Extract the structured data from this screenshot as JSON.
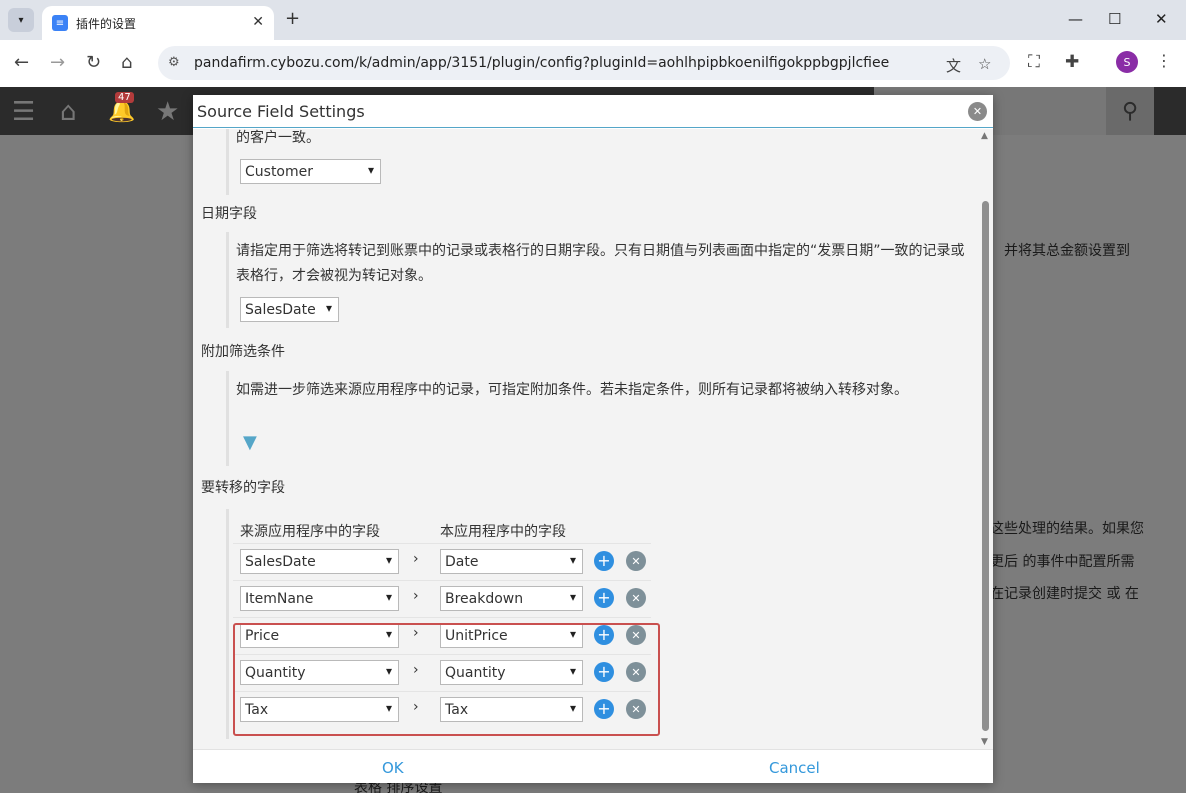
{
  "browser": {
    "tab_title": "插件的设置",
    "url": "pandafirm.cybozu.com/k/admin/app/3151/plugin/config?pluginId=aohlhpipbkoenilfigokppbgpjlcfiee",
    "profile_initial": "S",
    "icons": {
      "tab_menu": "▾",
      "close": "✕",
      "new_tab": "+",
      "minimize": "—",
      "maximize": "☐",
      "back": "←",
      "forward": "→",
      "reload": "↻",
      "home": "⌂",
      "site_info": "⚙",
      "translate": "文",
      "bookmark": "☆",
      "screenshot": "⛶",
      "extensions": "✚",
      "menu": "⋮"
    }
  },
  "app_header": {
    "notification_count": "47",
    "icons": {
      "menu": "☰",
      "home": "⌂",
      "bell": "🔔",
      "star": "★",
      "search": "⚲"
    }
  },
  "background_text": {
    "line1": "并将其总金额设置到",
    "line2": "这些处理的结果。如果您",
    "line3": "更后 的事件中配置所需",
    "line4": "在记录创建时提交 或 在",
    "bottom": "表格    排序设置"
  },
  "dialog": {
    "title": "Source Field Settings",
    "close_icon": "✕",
    "top_desc": "的客户一致。",
    "customer_select": "Customer",
    "date_section": {
      "label": "日期字段",
      "desc": "请指定用于筛选将转记到账票中的记录或表格行的日期字段。只有日期值与列表画面中指定的“发票日期”一致的记录或表格行，才会被视为转记对象。",
      "select": "SalesDate"
    },
    "filter_section": {
      "label": "附加筛选条件",
      "desc": "如需进一步筛选来源应用程序中的记录，可指定附加条件。若未指定条件，则所有记录都将被纳入转移对象。",
      "filter_icon": "▼"
    },
    "fields_section": {
      "label": "要转移的字段",
      "col_source": "来源应用程序中的字段",
      "col_target": "本应用程序中的字段",
      "arrow": "›",
      "add_icon": "+",
      "delete_icon": "✕",
      "rows": [
        {
          "source": "SalesDate",
          "target": "Date"
        },
        {
          "source": "ItemNane",
          "target": "Breakdown"
        },
        {
          "source": "Price",
          "target": "UnitPrice"
        },
        {
          "source": "Quantity",
          "target": "Quantity"
        },
        {
          "source": "Tax",
          "target": "Tax"
        }
      ]
    },
    "ok_label": "OK",
    "cancel_label": "Cancel"
  },
  "colors": {
    "accent": "#3498db",
    "add_button": "#2f8fe0",
    "highlight_border": "#c9504f",
    "header_line": "#55a6c8"
  }
}
